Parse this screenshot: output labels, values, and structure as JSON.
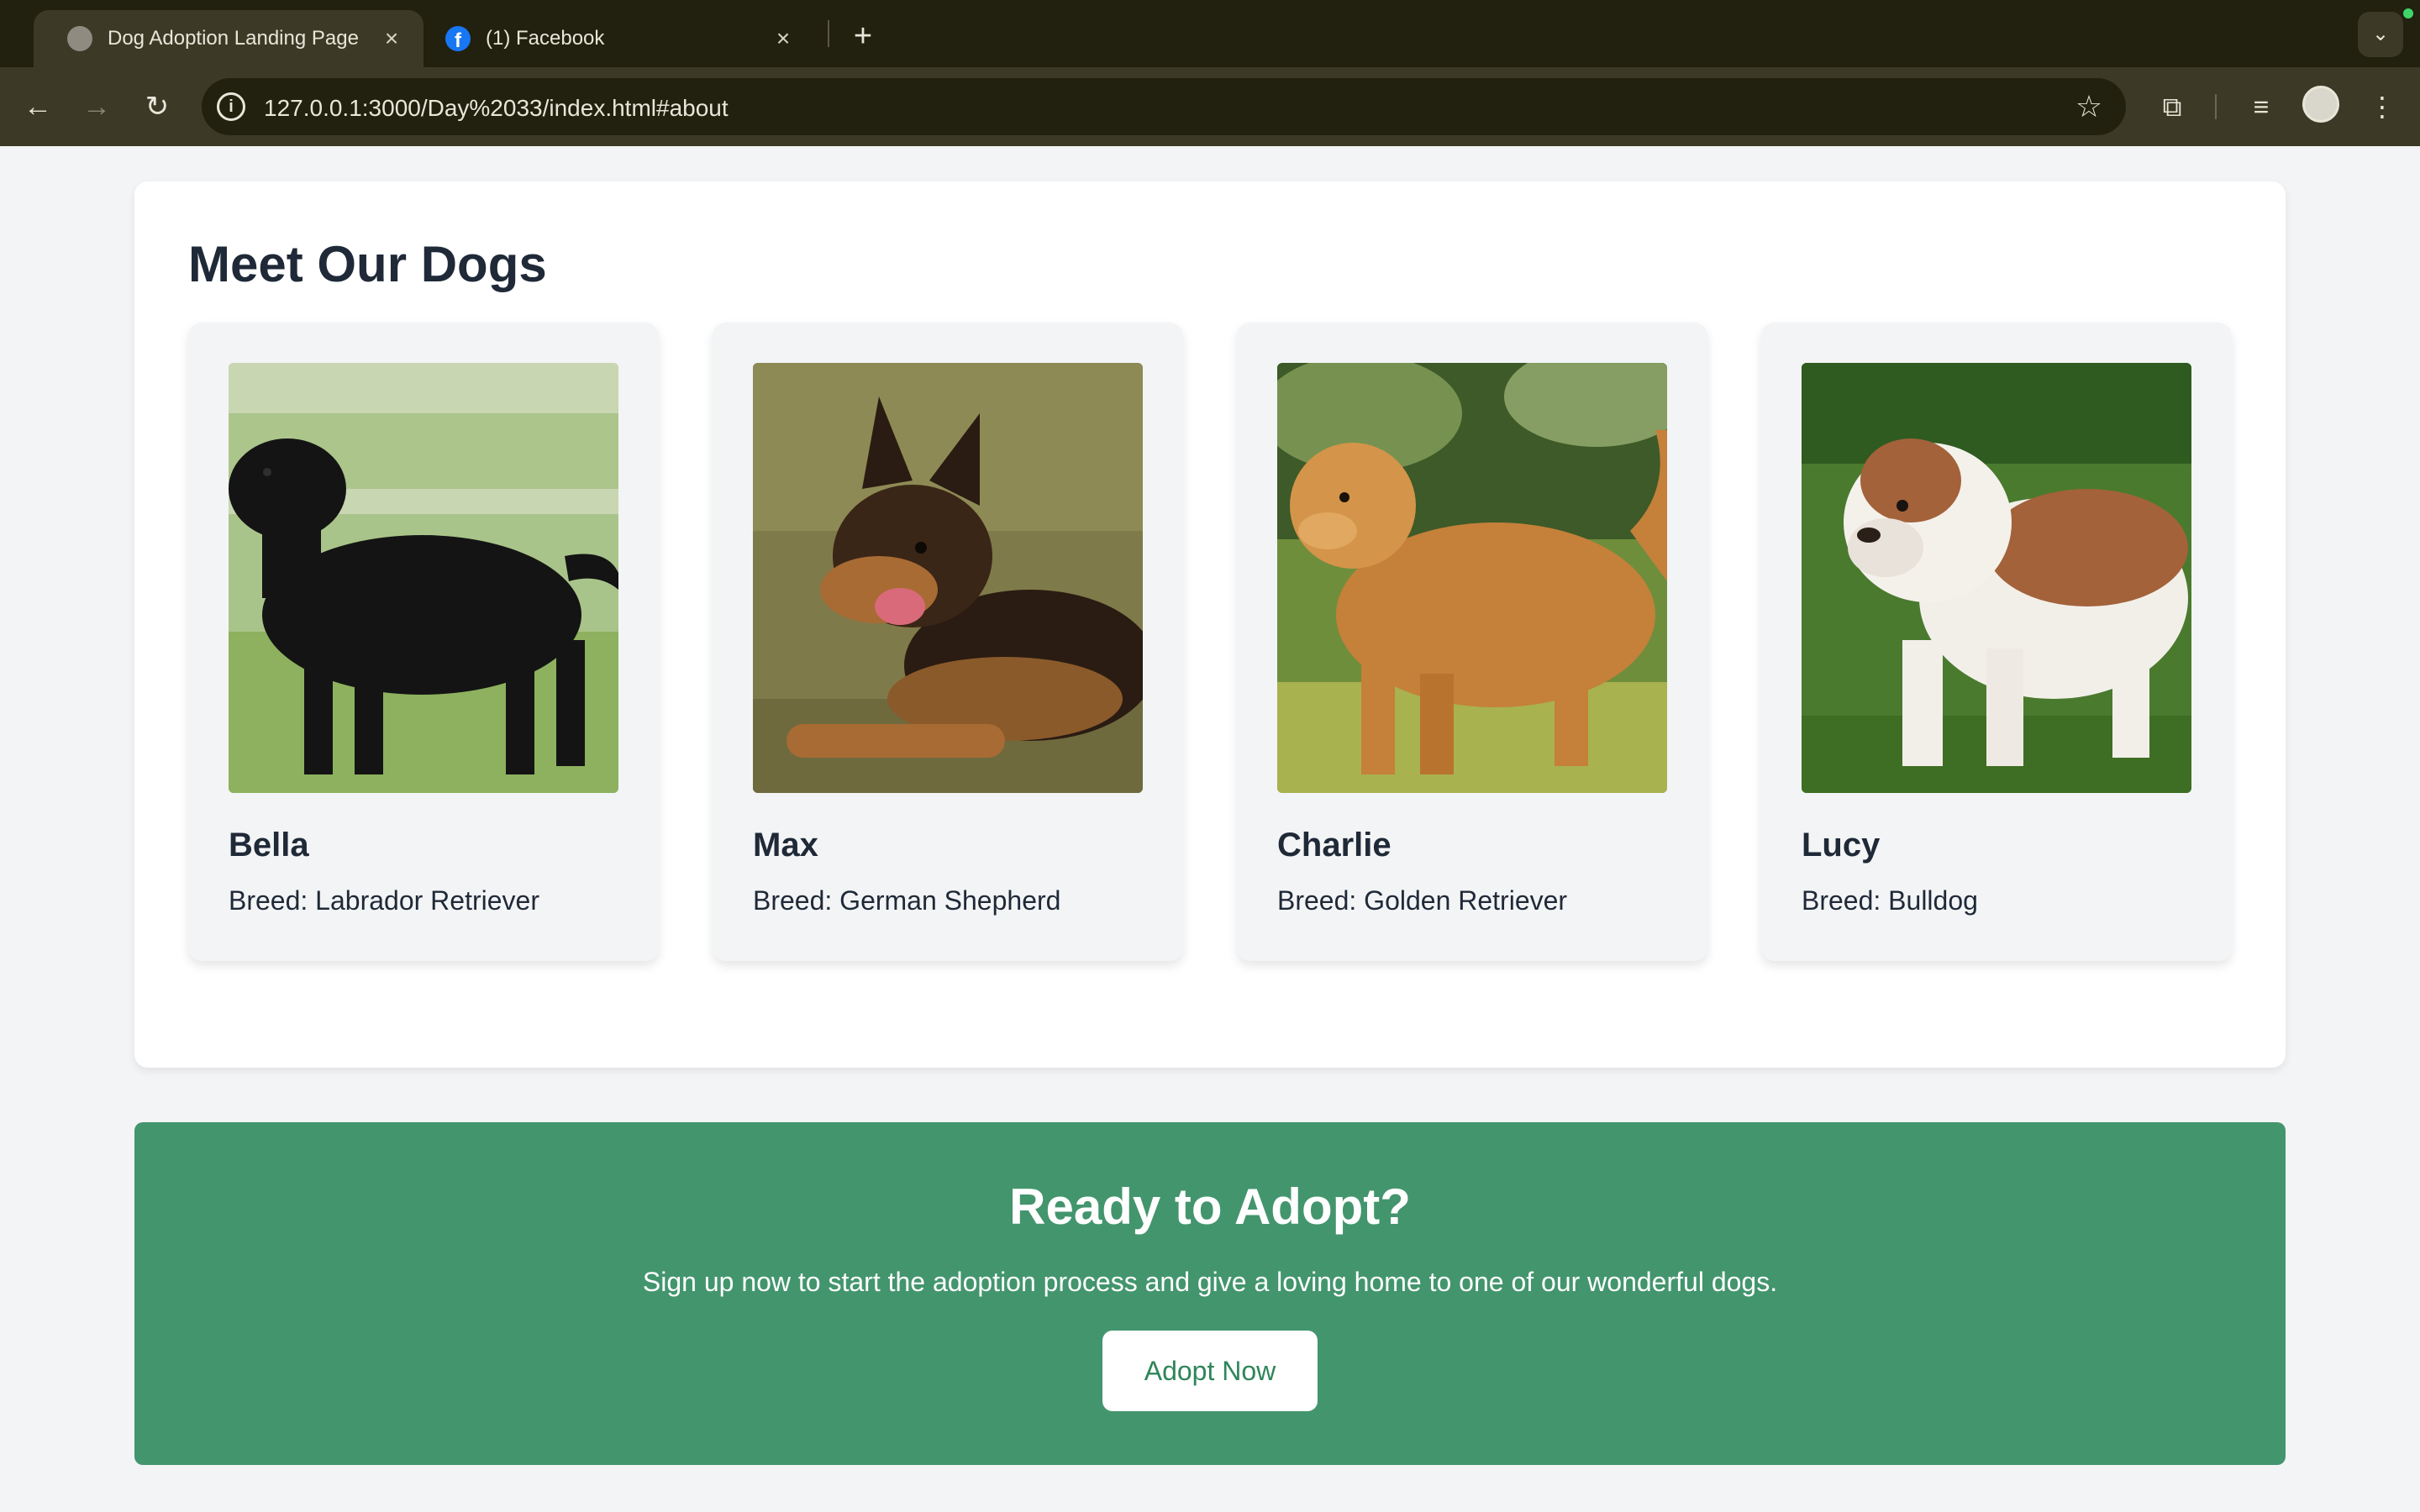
{
  "browser": {
    "tabs": [
      {
        "title": "Dog Adoption Landing Page",
        "icon": "globe-icon",
        "active": true
      },
      {
        "title": "(1) Facebook",
        "icon": "facebook-icon",
        "active": false
      }
    ],
    "url": "127.0.0.1:3000/Day%2033/index.html#about",
    "icons": {
      "close": "×",
      "new_tab": "+",
      "tab_search": "⌄",
      "back": "←",
      "forward": "→",
      "reload": "↻",
      "info": "i",
      "star": "☆",
      "extensions": "⧉",
      "media": "≡",
      "menu": "⋮",
      "facebook_glyph": "f"
    }
  },
  "dogs_section": {
    "title": "Meet Our Dogs",
    "dogs": [
      {
        "name": "Bella",
        "breed": "Breed: Labrador Retriever",
        "photo": "black-labrador-photo"
      },
      {
        "name": "Max",
        "breed": "Breed: German Shepherd",
        "photo": "german-shepherd-photo"
      },
      {
        "name": "Charlie",
        "breed": "Breed: Golden Retriever",
        "photo": "golden-retriever-photo"
      },
      {
        "name": "Lucy",
        "breed": "Breed: Bulldog",
        "photo": "bulldog-photo"
      }
    ]
  },
  "adopt_section": {
    "title": "Ready to Adopt?",
    "text": "Sign up now to start the adoption process and give a loving home to one of our wonderful dogs.",
    "button_label": "Adopt Now",
    "background_color": "#43956d",
    "button_text_color": "#2f855a"
  }
}
